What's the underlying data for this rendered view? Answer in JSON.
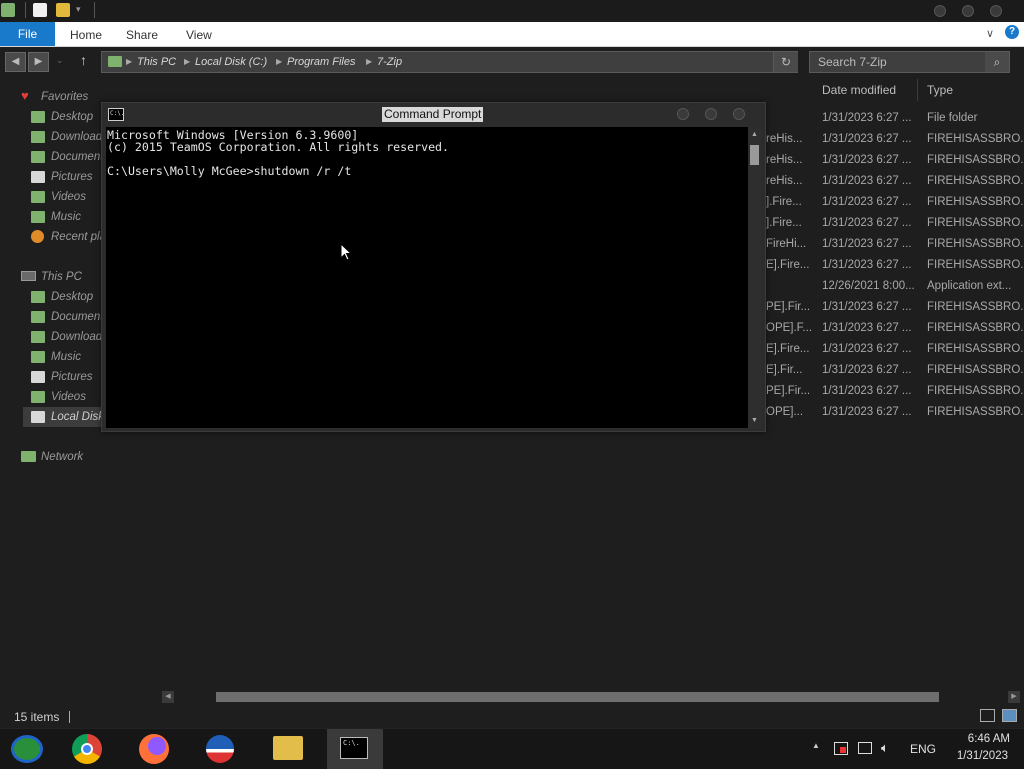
{
  "explorer": {
    "ribbon_tabs": [
      "File",
      "Home",
      "Share",
      "View"
    ],
    "breadcrumb": [
      "This PC",
      "Local Disk (C:)",
      "Program Files",
      "7-Zip"
    ],
    "search_placeholder": "Search 7-Zip",
    "columns": {
      "date": "Date modified",
      "type": "Type"
    },
    "sidebar": {
      "favorites_label": "Favorites",
      "favorites": [
        "Desktop",
        "Downloads",
        "Documents",
        "Pictures",
        "Videos",
        "Music",
        "Recent places"
      ],
      "thispc_label": "This PC",
      "thispc": [
        "Desktop",
        "Documents",
        "Downloads",
        "Music",
        "Pictures",
        "Videos",
        "Local Disk (C:)"
      ],
      "network_label": "Network"
    },
    "rows": [
      {
        "name": "",
        "date": "1/31/2023 6:27 ...",
        "type": "File folder"
      },
      {
        "name": "reHis...",
        "date": "1/31/2023 6:27 ...",
        "type": "FIREHISASSBRO..."
      },
      {
        "name": "reHis...",
        "date": "1/31/2023 6:27 ...",
        "type": "FIREHISASSBRO..."
      },
      {
        "name": "reHis...",
        "date": "1/31/2023 6:27 ...",
        "type": "FIREHISASSBRO..."
      },
      {
        "name": "].Fire...",
        "date": "1/31/2023 6:27 ...",
        "type": "FIREHISASSBRO..."
      },
      {
        "name": "].Fire...",
        "date": "1/31/2023 6:27 ...",
        "type": "FIREHISASSBRO..."
      },
      {
        "name": "FireHi...",
        "date": "1/31/2023 6:27 ...",
        "type": "FIREHISASSBRO..."
      },
      {
        "name": "E].Fire...",
        "date": "1/31/2023 6:27 ...",
        "type": "FIREHISASSBRO..."
      },
      {
        "name": "",
        "date": "12/26/2021 8:00...",
        "type": "Application ext..."
      },
      {
        "name": "PE].Fir...",
        "date": "1/31/2023 6:27 ...",
        "type": "FIREHISASSBRO..."
      },
      {
        "name": "OPE].F...",
        "date": "1/31/2023 6:27 ...",
        "type": "FIREHISASSBRO..."
      },
      {
        "name": "E].Fire...",
        "date": "1/31/2023 6:27 ...",
        "type": "FIREHISASSBRO..."
      },
      {
        "name": "E].Fir...",
        "date": "1/31/2023 6:27 ...",
        "type": "FIREHISASSBRO..."
      },
      {
        "name": "PE].Fir...",
        "date": "1/31/2023 6:27 ...",
        "type": "FIREHISASSBRO..."
      },
      {
        "name": "OPE]...",
        "date": "1/31/2023 6:27 ...",
        "type": "FIREHISASSBRO..."
      }
    ],
    "status_text": "15 items"
  },
  "cmd": {
    "title": "Command Prompt",
    "icon_text": "C:\\.",
    "lines": [
      "Microsoft Windows [Version 6.3.9600]",
      "(c) 2015 TeamOS Corporation. All rights reserved.",
      "",
      "C:\\Users\\Molly McGee>shutdown /r /t"
    ]
  },
  "taskbar": {
    "apps": [
      "windows-media-center",
      "chrome",
      "firefox",
      "obama-campaign",
      "file-explorer",
      "command-prompt"
    ],
    "language": "ENG",
    "time": "6:46 AM",
    "date": "1/31/2023"
  },
  "colors": {
    "accent": "#1979ca",
    "console_bg": "#000000",
    "window_bg": "#1e1e1e"
  }
}
